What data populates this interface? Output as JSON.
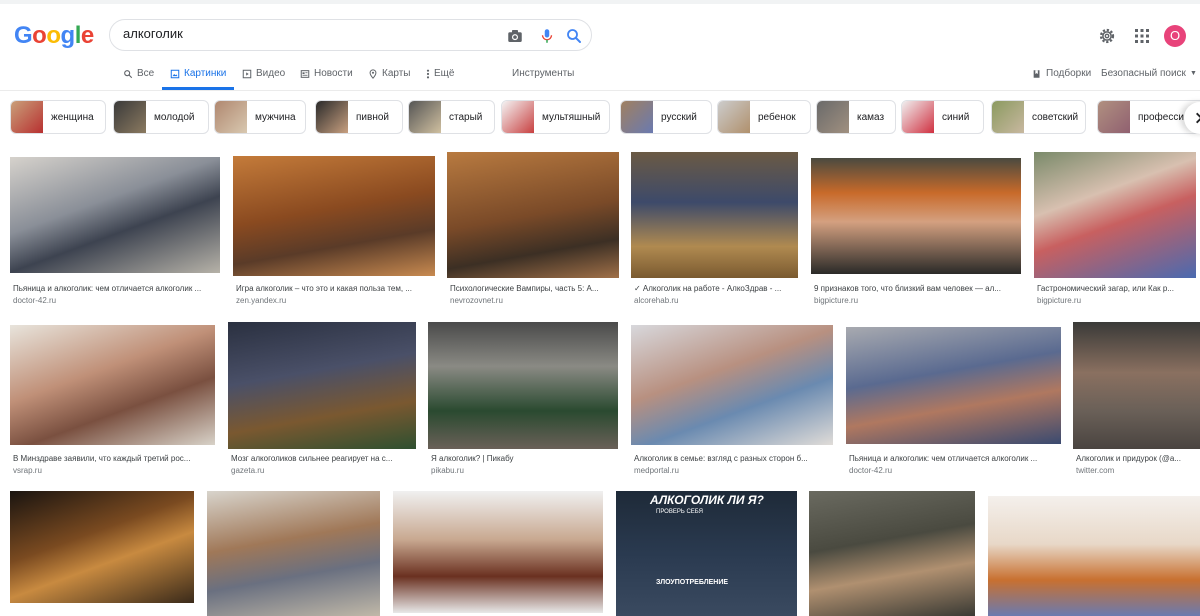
{
  "logo": {
    "letters": [
      "G",
      "o",
      "o",
      "g",
      "l",
      "e"
    ],
    "colors": [
      "#4285f4",
      "#ea4335",
      "#fbbc05",
      "#4285f4",
      "#34a853",
      "#ea4335"
    ]
  },
  "search": {
    "query": "алкоголик"
  },
  "icons": {
    "camera": "camera-icon",
    "mic": "mic-icon",
    "search": "search-icon",
    "settings": "gear-icon",
    "apps": "apps-grid-icon"
  },
  "user": {
    "avatar_letter": "О",
    "avatar_color": "#e8437a"
  },
  "tabs": [
    {
      "label": "Все",
      "icon": "search-icon"
    },
    {
      "label": "Картинки",
      "icon": "image-icon",
      "active": true
    },
    {
      "label": "Видео",
      "icon": "play-icon"
    },
    {
      "label": "Новости",
      "icon": "news-icon"
    },
    {
      "label": "Карты",
      "icon": "map-pin-icon"
    },
    {
      "label": "Ещё",
      "icon": "more-icon"
    }
  ],
  "tools_label": "Инструменты",
  "right_links": {
    "collections": "Подборки",
    "safe_search": "Безопасный поиск"
  },
  "chips": [
    "женщина",
    "молодой",
    "мужчина",
    "пивной",
    "старый",
    "мультяшный",
    "русский",
    "ребенок",
    "камаз",
    "синий",
    "советский",
    "професси"
  ],
  "results": [
    {
      "caption": "Пьяница и алкоголик: чем отличается алкоголик ...",
      "source": "doctor-42.ru"
    },
    {
      "caption": "Игра алкоголик – что это и какая польза тем, ...",
      "source": "zen.yandex.ru"
    },
    {
      "caption": "Психологические Вампиры, часть 5: А...",
      "source": "nevrozovnet.ru"
    },
    {
      "caption": "✓ Алкоголик на работе - АлкоЗдрав - ...",
      "source": "alcorehab.ru"
    },
    {
      "caption": "9 признаков того, что близкий вам человек — ал...",
      "source": "bigpicture.ru"
    },
    {
      "caption": "Гастрономический загар, или Как р...",
      "source": "bigpicture.ru"
    },
    {
      "caption": "В Минздраве заявили, что каждый третий рос...",
      "source": "vsrap.ru"
    },
    {
      "caption": "Мозг алкоголиков сильнее реагирует на с...",
      "source": "gazeta.ru"
    },
    {
      "caption": "Я алкоголик? | Пикабу",
      "source": "pikabu.ru"
    },
    {
      "caption": "Алкоголик в семье: взгляд с разных сторон б...",
      "source": "medportal.ru"
    },
    {
      "caption": "Пьяница и алкоголик: чем отличается алкоголик ...",
      "source": "doctor-42.ru"
    },
    {
      "caption": "Алкоголик и придурок (@а...",
      "source": "twitter.com"
    },
    {
      "caption": "",
      "source": ""
    },
    {
      "caption": "",
      "source": ""
    },
    {
      "caption": "",
      "source": ""
    },
    {
      "caption": "",
      "source": ""
    },
    {
      "caption": "",
      "source": ""
    },
    {
      "caption": "",
      "source": ""
    }
  ],
  "infographic": {
    "title": "АЛКОГОЛИК ЛИ Я?",
    "subtitle": "ПРОВЕРЬ СЕБЯ",
    "footer": "ЗЛОУПОТРЕБЛЕНИЕ"
  }
}
